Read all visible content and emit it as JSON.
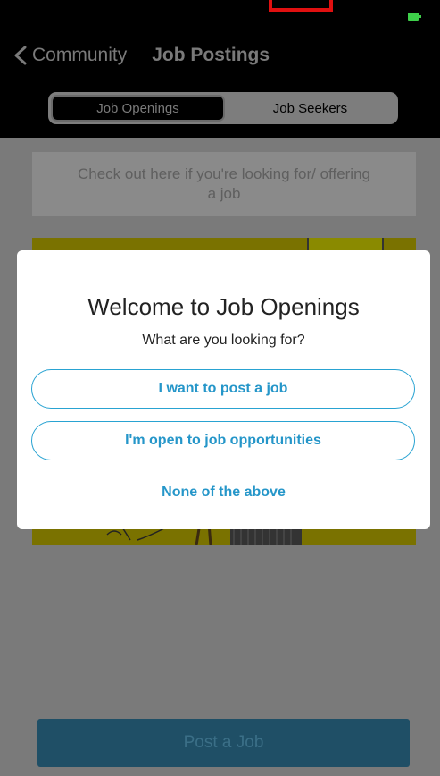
{
  "navbar": {
    "back_label": "Community",
    "title": "Job Postings"
  },
  "segments": [
    {
      "label": "Job Openings",
      "selected": true
    },
    {
      "label": "Job Seekers",
      "selected": false
    }
  ],
  "info_card": {
    "text": "Check out here if you're looking for/ offering a job"
  },
  "footer": {
    "post_job_label": "Post a Job"
  },
  "modal": {
    "title": "Welcome to Job Openings",
    "subtitle": "What are you looking for?",
    "options": [
      {
        "label": "I want to post a job"
      },
      {
        "label": "I'm open to job opportunities"
      }
    ],
    "dismiss_label": "None of the above"
  },
  "colors": {
    "accent": "#2596c9",
    "battery": "#3ecf4a",
    "highlight_box": "#e01010",
    "banner": "#f2e600"
  },
  "icons": [
    "back-chevron-icon",
    "battery-icon"
  ]
}
